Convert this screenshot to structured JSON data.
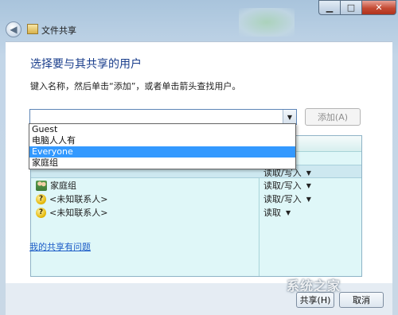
{
  "window": {
    "title": "文件共享",
    "minimize_glyph": "▁",
    "maximize_glyph": "□",
    "close_glyph": "✕",
    "back_glyph": "◀"
  },
  "main": {
    "heading": "选择要与其共享的用户",
    "instruction": "键入名称，然后单击“添加”，或者单击箭头查找用户。",
    "input_value": "",
    "combo_arrow": "▼",
    "add_button": "添加(A)",
    "dropdown": {
      "items": [
        "Guest",
        "电脑人人有",
        "Everyone",
        "家庭组"
      ],
      "selected_index": 2
    },
    "table": {
      "rows": [
        {
          "name": "家庭组",
          "icon": "group-icon",
          "level": "读取/写入",
          "caret": "▼"
        },
        {
          "name": "<未知联系人>",
          "icon": "unknown-contact-icon",
          "level": "读取/写入",
          "caret": "▼"
        },
        {
          "name": "<未知联系人>",
          "icon": "unknown-contact-icon",
          "level": "读取",
          "caret": "▼"
        }
      ],
      "partial_row": {
        "name": "",
        "level": "读取/写入",
        "caret": "▼"
      }
    },
    "help_link": "我的共享有问题"
  },
  "footer": {
    "share_button": "共享(H)",
    "cancel_button": "取消"
  },
  "watermark": "系统之家",
  "colors": {
    "heading": "#1a3e8c",
    "link": "#1c5cc7",
    "selection": "#3399ff",
    "table_bg": "#dff7f8"
  }
}
